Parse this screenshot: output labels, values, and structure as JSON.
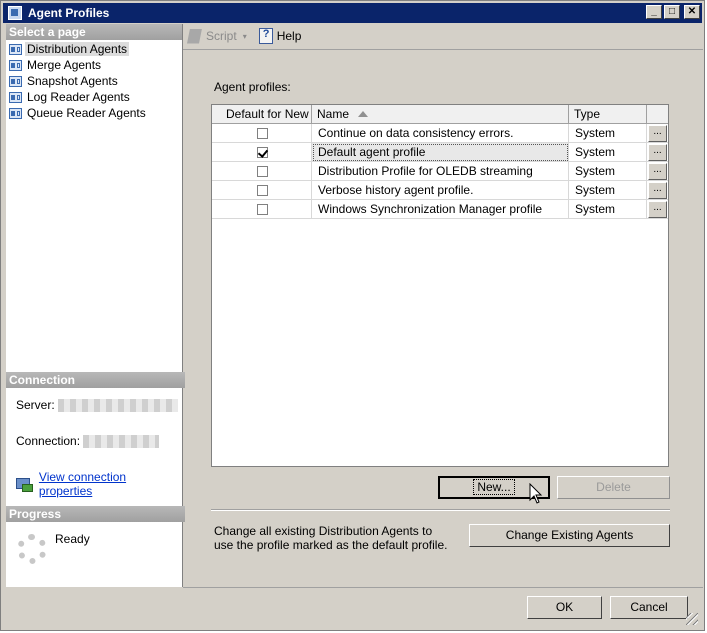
{
  "window": {
    "title": "Agent Profiles",
    "minimize": "_",
    "maximize": "□",
    "close": "✕"
  },
  "sidebar": {
    "select_header": "Select a page",
    "pages": [
      {
        "label": "Distribution Agents",
        "icon": "agent-page-icon"
      },
      {
        "label": "Merge Agents",
        "icon": "agent-page-icon"
      },
      {
        "label": "Snapshot Agents",
        "icon": "agent-page-icon"
      },
      {
        "label": "Log Reader Agents",
        "icon": "agent-page-icon"
      },
      {
        "label": "Queue Reader Agents",
        "icon": "agent-page-icon"
      }
    ],
    "connection_header": "Connection",
    "server_label": "Server:",
    "connection_label": "Connection:",
    "view_props_link": "View connection properties",
    "progress_header": "Progress",
    "progress_status": "Ready"
  },
  "toolbar": {
    "script_label": "Script",
    "script_dropdown": "▾",
    "help_label": "Help"
  },
  "main": {
    "profiles_label": "Agent profiles:",
    "columns": [
      "Default for New",
      "Name",
      "Type",
      ""
    ],
    "rows": [
      {
        "default": false,
        "name": "Continue on data consistency errors.",
        "type": "System",
        "action": "..."
      },
      {
        "default": true,
        "name": "Default agent profile",
        "type": "System",
        "action": "..."
      },
      {
        "default": false,
        "name": "Distribution Profile for OLEDB streaming",
        "type": "System",
        "action": "..."
      },
      {
        "default": false,
        "name": "Verbose history agent profile.",
        "type": "System",
        "action": "..."
      },
      {
        "default": false,
        "name": "Windows Synchronization Manager profile",
        "type": "System",
        "action": "..."
      }
    ],
    "new_button": "New...",
    "delete_button": "Delete",
    "change_text": "Change all existing Distribution Agents to use the profile marked as the default profile.",
    "change_button": "Change Existing Agents"
  },
  "footer": {
    "ok_button": "OK",
    "cancel_button": "Cancel"
  },
  "colors": {
    "titlebar": "#0a246a",
    "dialog": "#d4d0c8",
    "link": "#0033cc"
  }
}
